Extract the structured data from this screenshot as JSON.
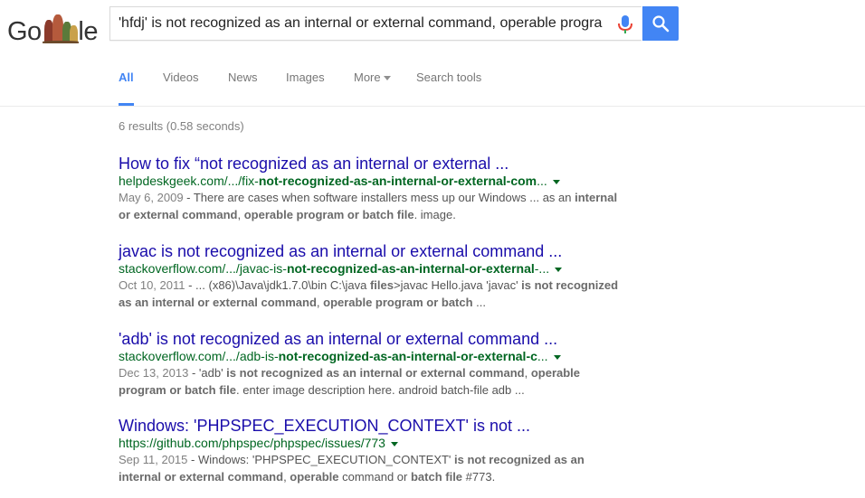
{
  "logo": {
    "prefix": "Go",
    "suffix": "le"
  },
  "search": {
    "query": "'hfdj' is not recognized as an internal or external command, operable program or batch file."
  },
  "tabs": [
    {
      "label": "All"
    },
    {
      "label": "Videos"
    },
    {
      "label": "News"
    },
    {
      "label": "Images"
    },
    {
      "label": "More"
    },
    {
      "label": "Search tools"
    }
  ],
  "stats": "6 results (0.58 seconds)",
  "results": [
    {
      "title": "How to fix “not recognized as an internal or external ...",
      "url_pre": "helpdeskgeek.com/.../fix-",
      "url_bold": "not-recognized-as-an-internal-or-external-com",
      "url_post": "...",
      "date": "May 6, 2009",
      "snippet": [
        {
          "t": " - There are cases when software installers mess up our Windows ... as an ",
          "b": false
        },
        {
          "t": "internal or external command",
          "b": true
        },
        {
          "t": ", ",
          "b": false
        },
        {
          "t": "operable program or batch file",
          "b": true
        },
        {
          "t": ". image.",
          "b": false
        }
      ]
    },
    {
      "title": "javac is not recognized as an internal or external command ...",
      "url_pre": "stackoverflow.com/.../javac-is-",
      "url_bold": "not-recognized-as-an-internal-or-external",
      "url_post": "-...",
      "date": "Oct 10, 2011",
      "snippet": [
        {
          "t": " - ... (x86)\\Java\\jdk1.7.0\\bin C:\\java ",
          "b": false
        },
        {
          "t": "files",
          "b": true
        },
        {
          "t": ">javac Hello.java 'javac' ",
          "b": false
        },
        {
          "t": "is not recognized as an internal or external command",
          "b": true
        },
        {
          "t": ", ",
          "b": false
        },
        {
          "t": "operable program or batch",
          "b": true
        },
        {
          "t": " ...",
          "b": false
        }
      ]
    },
    {
      "title": "'adb' is not recognized as an internal or external command ...",
      "url_pre": "stackoverflow.com/.../adb-is-",
      "url_bold": "not-recognized-as-an-internal-or-external-c",
      "url_post": "...",
      "date": "Dec 13, 2013",
      "snippet": [
        {
          "t": " - 'adb' ",
          "b": false
        },
        {
          "t": "is not recognized as an internal or external command",
          "b": true
        },
        {
          "t": ", ",
          "b": false
        },
        {
          "t": "operable program or batch file",
          "b": true
        },
        {
          "t": ". enter image description here. android batch-file adb ...",
          "b": false
        }
      ]
    },
    {
      "title": "Windows: 'PHPSPEC_EXECUTION_CONTEXT' is not ...",
      "url_pre": "https://github.com/phpspec/phpspec/issues/773",
      "url_bold": "",
      "url_post": "",
      "date": "Sep 11, 2015",
      "snippet": [
        {
          "t": " - Windows: 'PHPSPEC_EXECUTION_CONTEXT' ",
          "b": false
        },
        {
          "t": "is not recognized as an internal or external command",
          "b": true
        },
        {
          "t": ", ",
          "b": false
        },
        {
          "t": "operable",
          "b": true
        },
        {
          "t": " command or ",
          "b": false
        },
        {
          "t": "batch file",
          "b": true
        },
        {
          "t": " #773.",
          "b": false
        }
      ]
    }
  ],
  "colors": {
    "accent": "#4285f4",
    "link": "#1a0dab",
    "url": "#006621",
    "snippet": "#545454"
  }
}
